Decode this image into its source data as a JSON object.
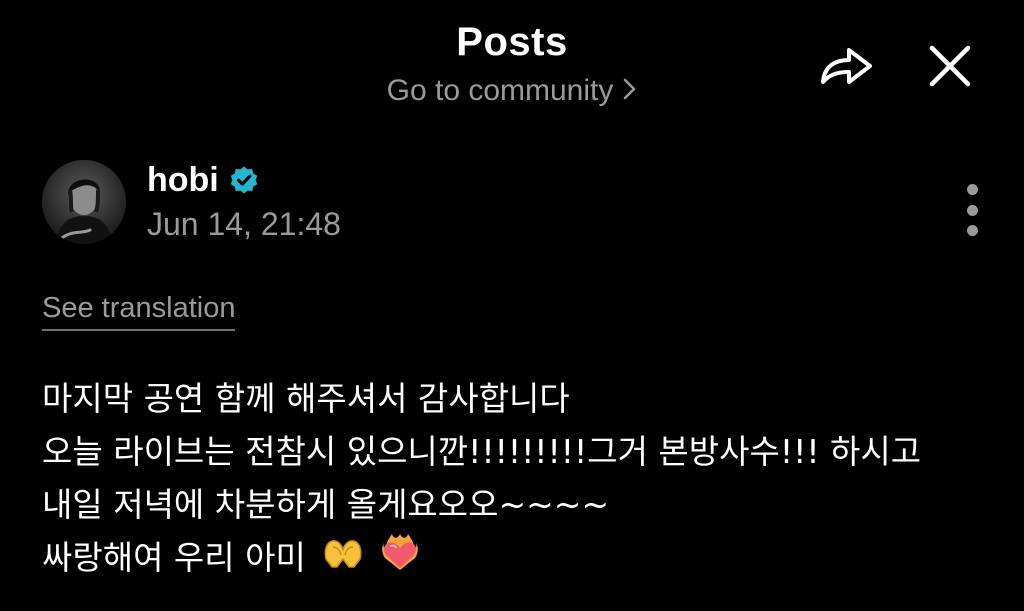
{
  "header": {
    "title": "Posts",
    "community_link": "Go to community",
    "icons": {
      "share": "share-arrow-icon",
      "close": "close-icon",
      "chevron": "chevron-right-icon"
    }
  },
  "post": {
    "author": {
      "name": "hobi",
      "verified": true,
      "avatar": "avatar-photo"
    },
    "timestamp": "Jun 14, 21:48",
    "see_translation": "See translation",
    "lines": [
      "마지막 공연 함께 해주셔서 감사합니다",
      "오늘 라이브는 전참시 있으니깐!!!!!!!!!그거 본방사수!!! 하시고",
      "내일 저녁에 차분하게 올게요오오~~~~",
      "싸랑해여 우리 아미"
    ],
    "line_emojis": [
      "heart-hands-emoji",
      "heart-on-fire-emoji"
    ]
  },
  "colors": {
    "background": "#000000",
    "primary_text": "#ffffff",
    "secondary_text": "#9a9a9a",
    "verified_badge": "#22b8cf"
  }
}
